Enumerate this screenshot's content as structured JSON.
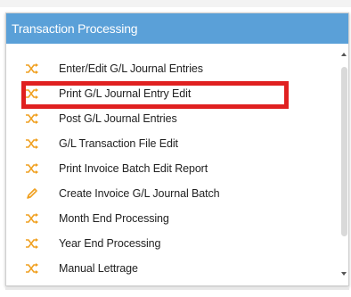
{
  "panel": {
    "title": "Transaction Processing"
  },
  "menu": {
    "items": [
      {
        "label": "Enter/Edit G/L Journal Entries",
        "icon": "shuffle-icon"
      },
      {
        "label": "Print G/L Journal Entry Edit",
        "icon": "shuffle-icon"
      },
      {
        "label": "Post G/L Journal Entries",
        "icon": "shuffle-icon"
      },
      {
        "label": "G/L Transaction File Edit",
        "icon": "shuffle-icon"
      },
      {
        "label": "Print Invoice Batch Edit Report",
        "icon": "shuffle-icon"
      },
      {
        "label": "Create Invoice G/L Journal Batch",
        "icon": "pencil-icon"
      },
      {
        "label": "Month End Processing",
        "icon": "shuffle-icon"
      },
      {
        "label": "Year End Processing",
        "icon": "shuffle-icon"
      },
      {
        "label": "Manual Lettrage",
        "icon": "shuffle-icon"
      }
    ]
  },
  "colors": {
    "header": "#5aa0d8",
    "icon": "#f0a020",
    "highlight": "#e02020"
  }
}
